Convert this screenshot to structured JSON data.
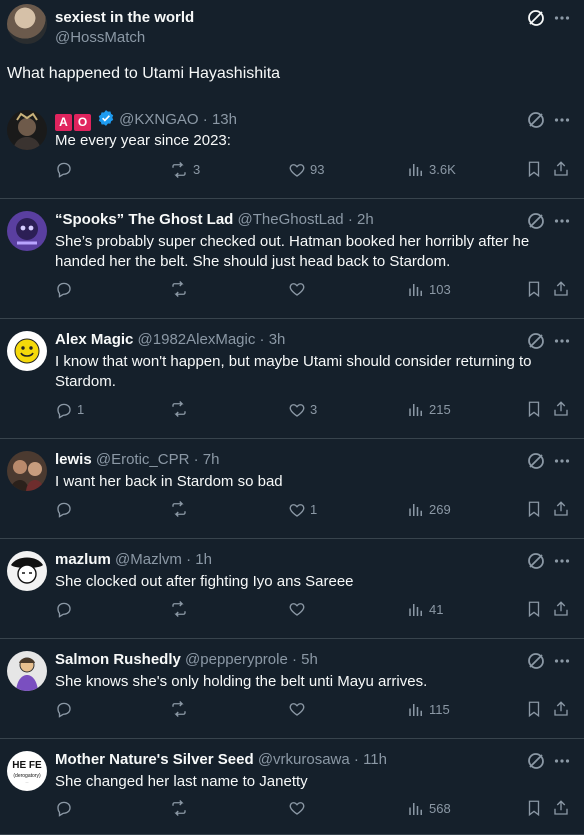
{
  "colors": {
    "bg": "#15202b",
    "text": "#f7f9f9",
    "muted": "#8b98a5",
    "divider": "#38444d",
    "accent": "#1d9bf0"
  },
  "original_post": {
    "display_name": "sexiest in the world",
    "handle": "@HossMatch",
    "text": "What happened to Utami Hayashishita"
  },
  "replies": [
    {
      "display_name": "",
      "badges": [
        "A",
        "O"
      ],
      "verified": true,
      "handle": "@KXNGAO",
      "time": "13h",
      "lines": [
        "Me every year since 2023:"
      ],
      "replies": "",
      "reposts": "3",
      "likes": "93",
      "views": "3.6K",
      "avatar": "dark-portrait"
    },
    {
      "display_name": "“Spooks” The Ghost Lad",
      "handle": "@TheGhostLad",
      "time": "2h",
      "lines": [
        "She’s probably super checked out. Hatman booked her horribly after he",
        "handed her the belt. She should just head back to Stardom."
      ],
      "replies": "",
      "reposts": "",
      "likes": "",
      "views": "103",
      "avatar": "purple-ghost"
    },
    {
      "display_name": "Alex Magic",
      "handle": "@1982AlexMagic",
      "time": "3h",
      "lines": [
        "I know that won't happen, but maybe Utami should consider returning to",
        "Stardom."
      ],
      "replies": "1",
      "reposts": "",
      "likes": "3",
      "views": "215",
      "avatar": "smiley"
    },
    {
      "display_name": "lewis",
      "handle": "@Erotic_CPR",
      "time": "7h",
      "lines": [
        "I want her back in Stardom so bad"
      ],
      "replies": "",
      "reposts": "",
      "likes": "1",
      "views": "269",
      "avatar": "photo-collage"
    },
    {
      "display_name": "mazlum",
      "handle": "@Mazlvm",
      "time": "1h",
      "lines": [
        "She clocked out after fighting Iyo ans Sareee"
      ],
      "replies": "",
      "reposts": "",
      "likes": "",
      "views": "41",
      "avatar": "anime-sketch"
    },
    {
      "display_name": "Salmon Rushedly",
      "handle": "@pepperyprole",
      "time": "5h",
      "lines": [
        "She knows she's only holding the belt unti Mayu arrives."
      ],
      "replies": "",
      "reposts": "",
      "likes": "",
      "views": "115",
      "avatar": "cartoon-figure"
    },
    {
      "display_name": "Mother Nature's Silver Seed",
      "handle": "@vrkurosawa",
      "time": "11h",
      "lines": [
        "She changed her last name to Janetty"
      ],
      "replies": "",
      "reposts": "",
      "likes": "",
      "views": "568",
      "avatar": "text-logo",
      "avatar_text": "HE FE"
    }
  ]
}
